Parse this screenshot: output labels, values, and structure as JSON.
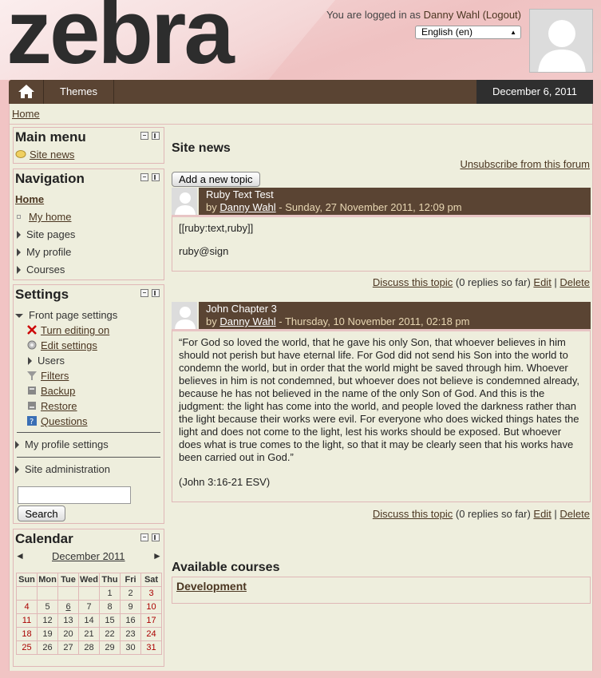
{
  "header": {
    "logo": "zebra",
    "login_prefix": "You are logged in as ",
    "user_name": "Danny Wahl",
    "logout": "(Logout)",
    "language": "English (en)"
  },
  "nav": {
    "themes": "Themes",
    "date": "December 6, 2011"
  },
  "breadcrumb": {
    "home": "Home"
  },
  "main_menu": {
    "title": "Main menu",
    "site_news": "Site news"
  },
  "navigation": {
    "title": "Navigation",
    "home": "Home",
    "my_home": "My home",
    "site_pages": "Site pages",
    "my_profile": "My profile",
    "courses": "Courses"
  },
  "settings": {
    "title": "Settings",
    "front_page": "Front page settings",
    "turn_editing": "Turn editing on",
    "edit_settings": "Edit settings",
    "users": "Users",
    "filters": "Filters",
    "backup": "Backup",
    "restore": "Restore",
    "questions": "Questions",
    "my_profile_settings": "My profile settings",
    "site_admin": "Site administration",
    "search_button": "Search"
  },
  "calendar": {
    "title": "Calendar",
    "prev": "◄",
    "next": "►",
    "month": "December 2011",
    "days": [
      "Sun",
      "Mon",
      "Tue",
      "Wed",
      "Thu",
      "Fri",
      "Sat"
    ],
    "weeks": [
      [
        "",
        "",
        "",
        "",
        "1",
        "2",
        "3"
      ],
      [
        "4",
        "5",
        "6",
        "7",
        "8",
        "9",
        "10"
      ],
      [
        "11",
        "12",
        "13",
        "14",
        "15",
        "16",
        "17"
      ],
      [
        "18",
        "19",
        "20",
        "21",
        "22",
        "23",
        "24"
      ],
      [
        "25",
        "26",
        "27",
        "28",
        "29",
        "30",
        "31"
      ]
    ]
  },
  "site_news": {
    "title": "Site news",
    "unsubscribe": "Unsubscribe from this forum",
    "add_topic": "Add a new topic",
    "by": "by ",
    "discuss": "Discuss this topic",
    "replies": " (0 replies so far) ",
    "edit": "Edit",
    "pipe": " | ",
    "delete": "Delete",
    "posts": [
      {
        "subject": "Ruby Text Test",
        "author": "Danny Wahl",
        "date": " - Sunday, 27 November 2011, 12:09 pm",
        "paragraphs": [
          "[[ruby:text,ruby]]",
          "ruby@sign"
        ]
      },
      {
        "subject": "John Chapter 3",
        "author": "Danny Wahl",
        "date": " - Thursday, 10 November 2011, 02:18 pm",
        "paragraphs": [
          "“For God so loved the world, that he gave his only Son, that whoever believes in him should not perish but have eternal life. For God did not send his Son into the world to condemn the world, but in order that the world might be saved through him. Whoever believes in him is not condemned, but whoever does not believe is condemned already, because he has not believed in the name of the only Son of God. And this is the judgment: the light has come into the world, and people loved the darkness rather than the light because their works were evil. For everyone who does wicked things hates the light and does not come to the light, lest his works should be exposed. But whoever does what is true comes to the light, so that it may be clearly seen that his works have been carried out in God.”",
          "(John 3:16-21 ESV)"
        ]
      }
    ]
  },
  "courses": {
    "title": "Available courses",
    "course": "Development"
  }
}
